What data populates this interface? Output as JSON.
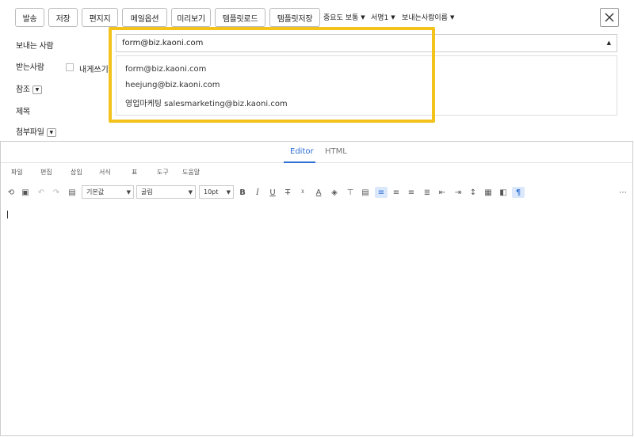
{
  "toolbar": {
    "buttons": [
      "발송",
      "저장",
      "편지지",
      "메일옵션",
      "미리보기",
      "템플릿로드",
      "템플릿저장"
    ],
    "importance": "중요도 보통",
    "signature": "서명1",
    "sender_name": "보내는사람이름"
  },
  "form": {
    "from_label": "보내는 사람",
    "from_value": "form@biz.kaoni.com",
    "to_label": "받는사람",
    "self_label": "내게쓰기",
    "cc_label": "참조",
    "subject_label": "제목",
    "attach_label": "첨부파일"
  },
  "sender_options": [
    "form@biz.kaoni.com",
    "heejung@biz.kaoni.com",
    "영업마케팅 salesmarketing@biz.kaoni.com"
  ],
  "editor": {
    "tabs": [
      "Editor",
      "HTML"
    ],
    "menus": [
      "파일",
      "편집",
      "삽입",
      "서식",
      "표",
      "도구",
      "도움말"
    ],
    "block_format": "기본값",
    "font_family": "굴림",
    "font_size": "10pt"
  },
  "colors": {
    "highlight": "#f3c21b",
    "accent": "#2c6ed5"
  }
}
